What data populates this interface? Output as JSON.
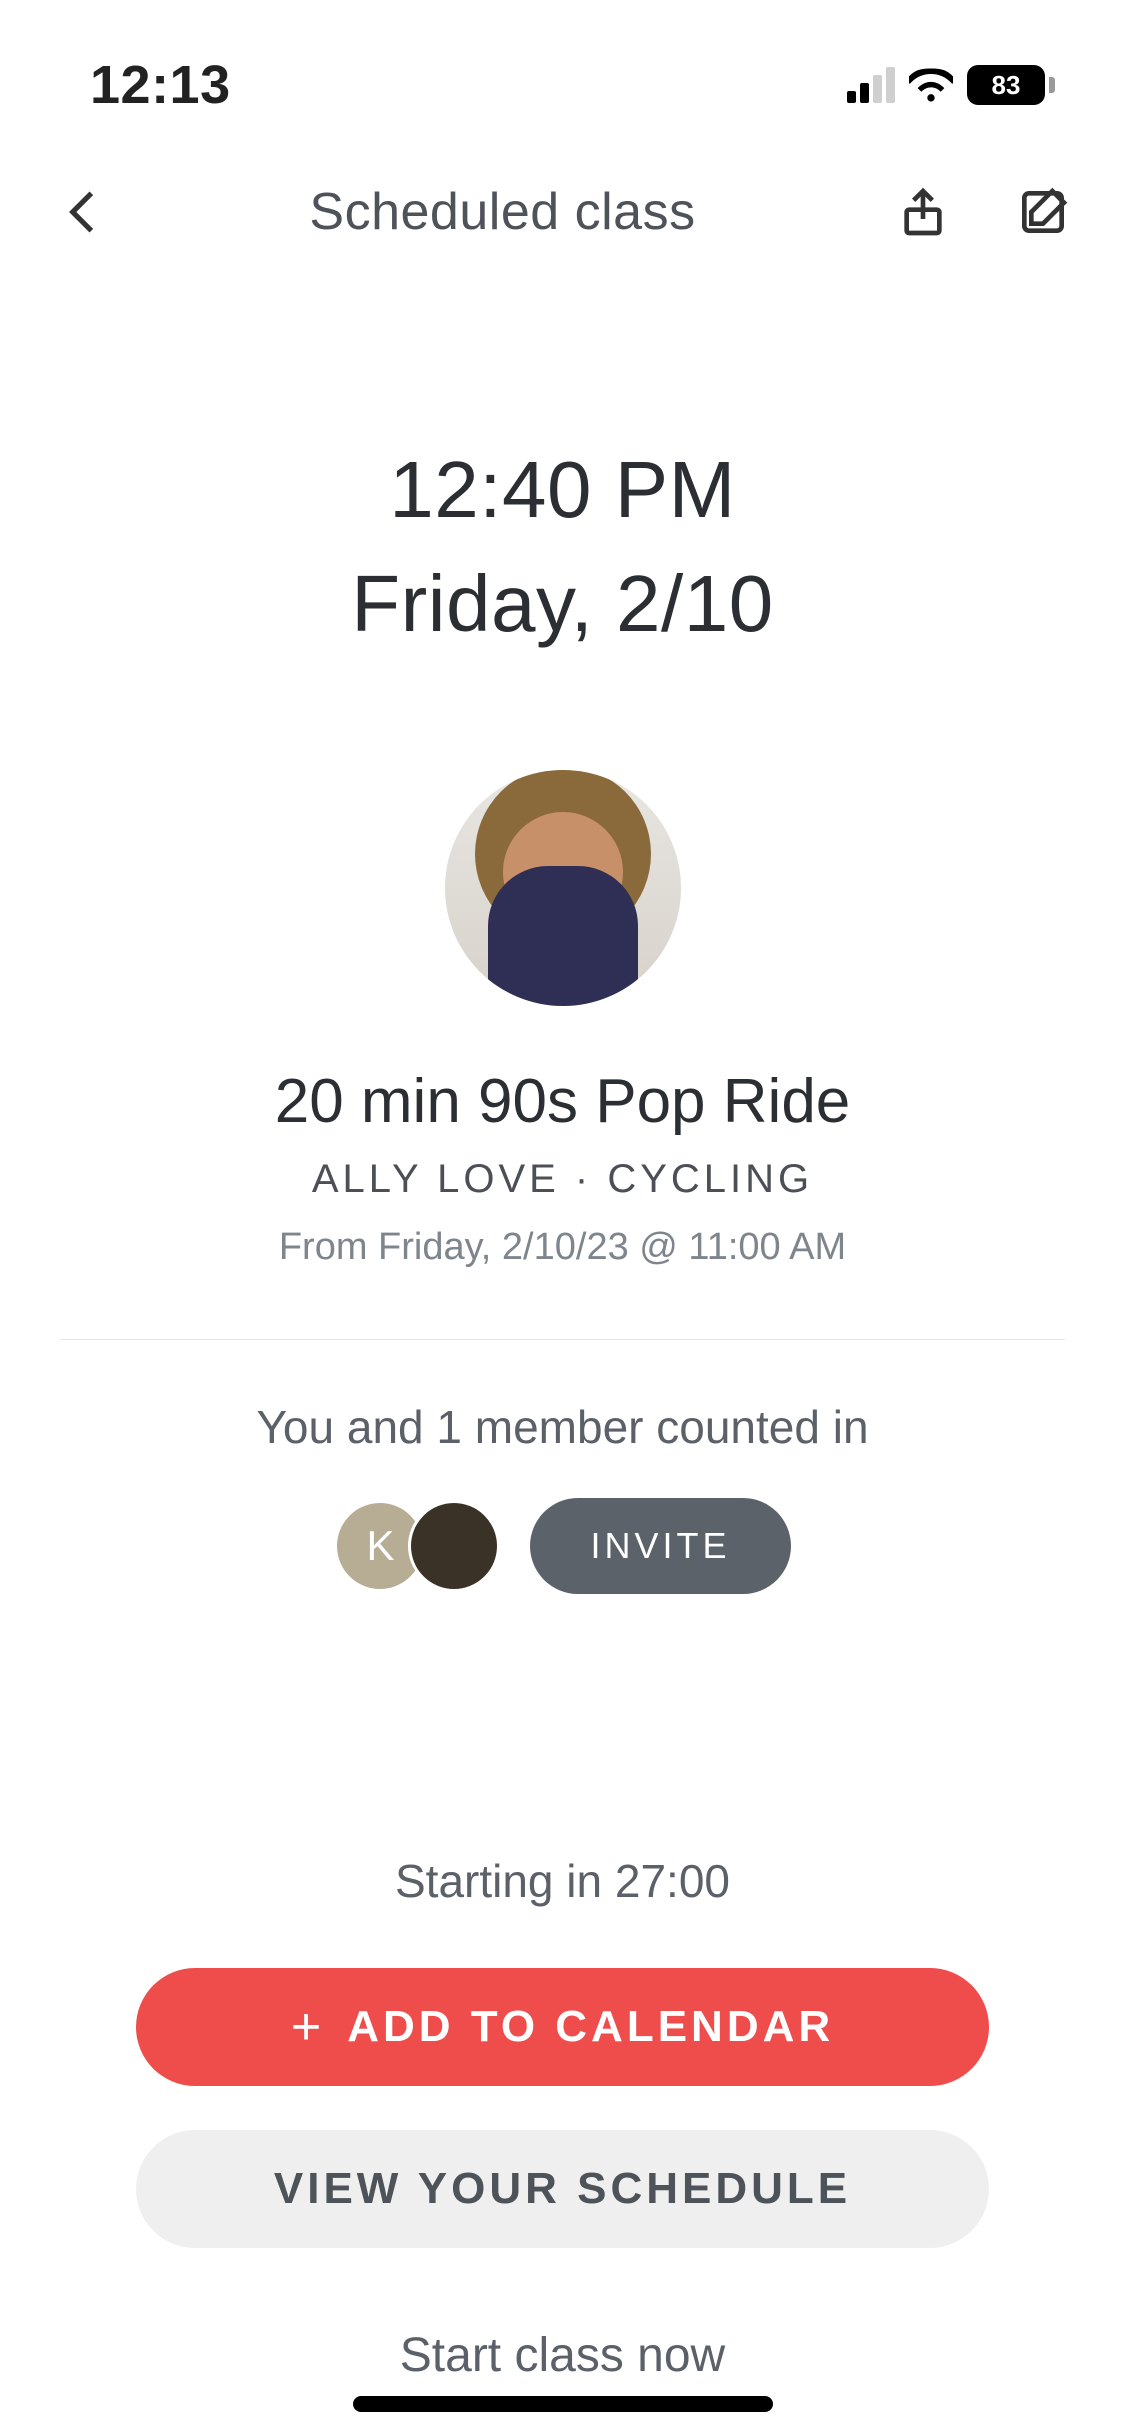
{
  "status": {
    "time": "12:13",
    "battery": "83"
  },
  "nav": {
    "title": "Scheduled class"
  },
  "schedule": {
    "time": "12:40 PM",
    "date": "Friday, 2/10"
  },
  "class": {
    "title": "20 min 90s Pop Ride",
    "subtitle": "ALLY LOVE  ·  CYCLING",
    "from": "From Friday, 2/10/23 @ 11:00 AM"
  },
  "counted": {
    "text": "You and 1 member counted in",
    "avatar1": "K",
    "invite": "INVITE"
  },
  "countdown": "Starting in 27:00",
  "buttons": {
    "add": "ADD TO CALENDAR",
    "view": "VIEW YOUR SCHEDULE"
  },
  "start_now": "Start class now"
}
